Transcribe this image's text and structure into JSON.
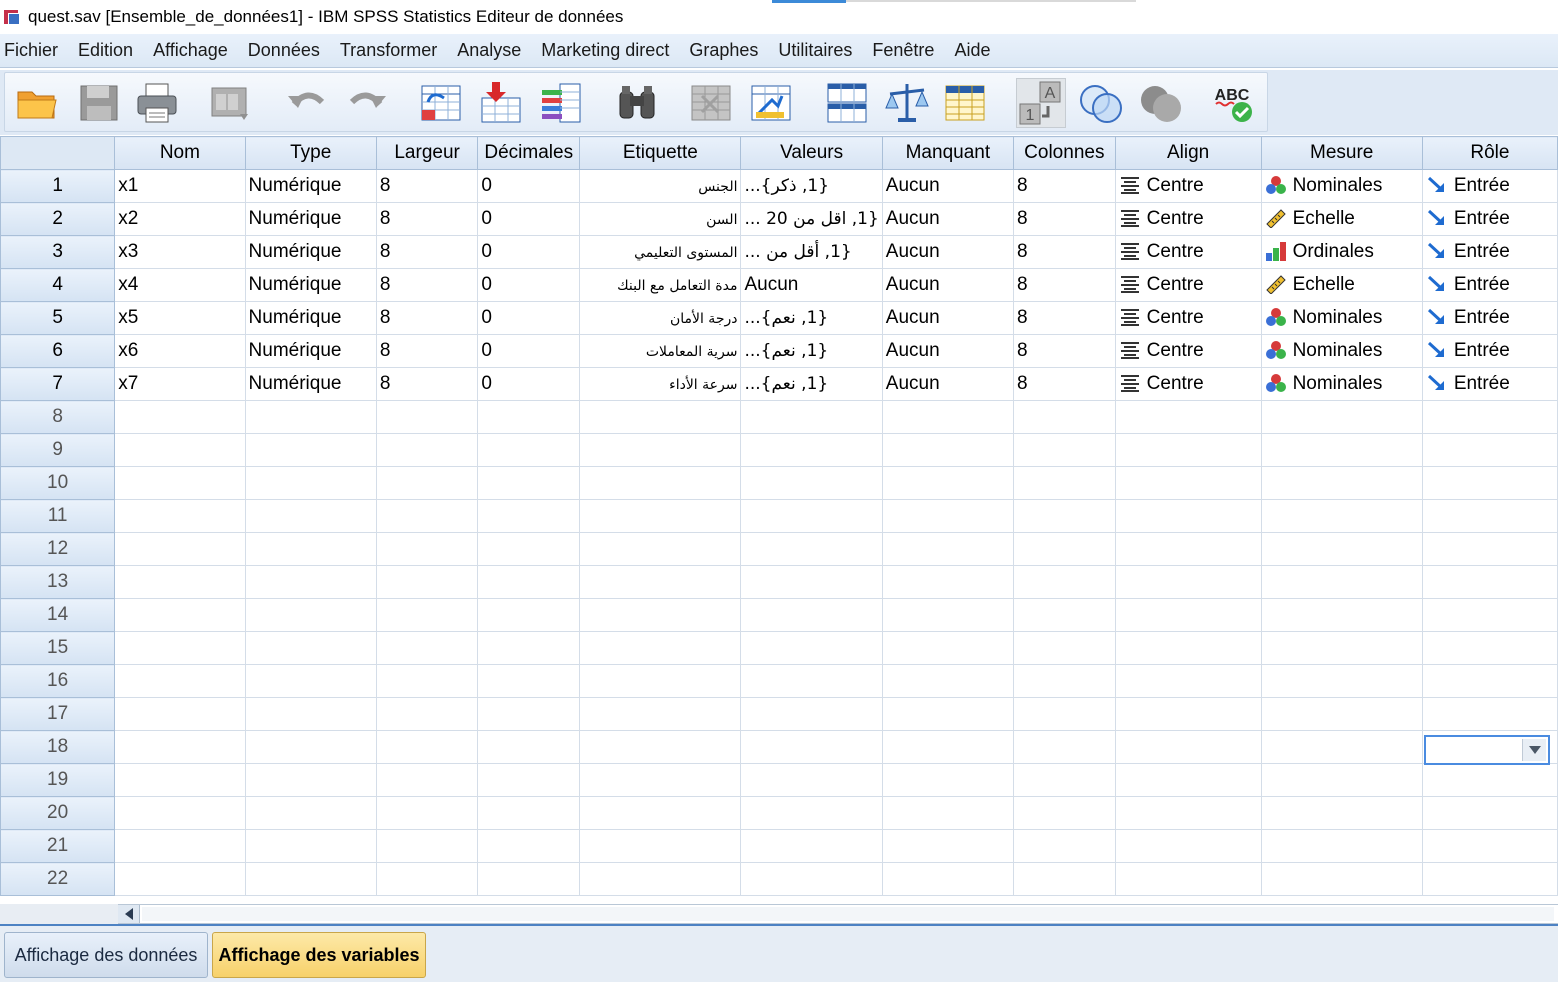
{
  "window": {
    "title": "quest.sav [Ensemble_de_données1] - IBM SPSS Statistics Editeur de données"
  },
  "menu": [
    "Fichier",
    "Edition",
    "Affichage",
    "Données",
    "Transformer",
    "Analyse",
    "Marketing direct",
    "Graphes",
    "Utilitaires",
    "Fenêtre",
    "Aide"
  ],
  "toolbar": {
    "buttons": [
      "open-file-icon",
      "save-icon",
      "print-icon",
      "recall-dialog-icon",
      "undo-icon",
      "redo-icon",
      "goto-case-icon",
      "goto-variable-icon",
      "variables-icon",
      "find-icon",
      "insert-cases-icon",
      "insert-variable-icon",
      "split-file-icon",
      "select-cases-icon",
      "weight-cases-icon",
      "value-labels-icon",
      "use-sets-icon",
      "show-all-variables-icon",
      "spell-check-icon"
    ]
  },
  "grid": {
    "columns": [
      "Nom",
      "Type",
      "Largeur",
      "Décimales",
      "Etiquette",
      "Valeurs",
      "Manquant",
      "Colonnes",
      "Align",
      "Mesure",
      "Rôle"
    ],
    "rows": [
      {
        "num": "1",
        "nom": "x1",
        "type": "Numérique",
        "largeur": "8",
        "decimales": "0",
        "etiquette": "الجنس",
        "valeurs": "{1, ذكر}...",
        "manquant": "Aucun",
        "colonnes": "8",
        "align": "Centre",
        "mesure": "Nominales",
        "mesure_icon": "nominal-icon",
        "role": "Entrée"
      },
      {
        "num": "2",
        "nom": "x2",
        "type": "Numérique",
        "largeur": "8",
        "decimales": "0",
        "etiquette": "السن",
        "valeurs": "{1, اقل من 20 ...",
        "manquant": "Aucun",
        "colonnes": "8",
        "align": "Centre",
        "mesure": "Echelle",
        "mesure_icon": "scale-icon",
        "role": "Entrée"
      },
      {
        "num": "3",
        "nom": "x3",
        "type": "Numérique",
        "largeur": "8",
        "decimales": "0",
        "etiquette": "المستوى التعليمي",
        "valeurs": "{1, أقل من ...",
        "manquant": "Aucun",
        "colonnes": "8",
        "align": "Centre",
        "mesure": "Ordinales",
        "mesure_icon": "ordinal-icon",
        "role": "Entrée"
      },
      {
        "num": "4",
        "nom": "x4",
        "type": "Numérique",
        "largeur": "8",
        "decimales": "0",
        "etiquette": "مدة التعامل مع البنك",
        "valeurs": "Aucun",
        "manquant": "Aucun",
        "colonnes": "8",
        "align": "Centre",
        "mesure": "Echelle",
        "mesure_icon": "scale-icon",
        "role": "Entrée"
      },
      {
        "num": "5",
        "nom": "x5",
        "type": "Numérique",
        "largeur": "8",
        "decimales": "0",
        "etiquette": "درجة الأمان",
        "valeurs": "{1, نعم}...",
        "manquant": "Aucun",
        "colonnes": "8",
        "align": "Centre",
        "mesure": "Nominales",
        "mesure_icon": "nominal-icon",
        "role": "Entrée"
      },
      {
        "num": "6",
        "nom": "x6",
        "type": "Numérique",
        "largeur": "8",
        "decimales": "0",
        "etiquette": "سرية المعاملات",
        "valeurs": "{1, نعم}...",
        "manquant": "Aucun",
        "colonnes": "8",
        "align": "Centre",
        "mesure": "Nominales",
        "mesure_icon": "nominal-icon",
        "role": "Entrée"
      },
      {
        "num": "7",
        "nom": "x7",
        "type": "Numérique",
        "largeur": "8",
        "decimales": "0",
        "etiquette": "سرعة الأداء",
        "valeurs": "{1, نعم}...",
        "manquant": "Aucun",
        "colonnes": "8",
        "align": "Centre",
        "mesure": "Nominales",
        "mesure_icon": "nominal-icon",
        "role": "Entrée"
      }
    ],
    "empty_rows": [
      "8",
      "9",
      "10",
      "11",
      "12",
      "13",
      "14",
      "15",
      "16",
      "17",
      "18",
      "19",
      "20",
      "21",
      "22"
    ],
    "align_icon": "align-center-icon",
    "role_icon": "input-arrow-icon",
    "active_cell": {
      "row": "14",
      "column": "Rôle",
      "value": ""
    }
  },
  "tabs": {
    "data_view": "Affichage des données",
    "variable_view": "Affichage des variables",
    "active": "variable_view"
  },
  "colors": {
    "header_bg": "#d7e4f3",
    "active_tab": "#f7d16a",
    "grid_line": "#d4dde8",
    "accent": "#4a8be0"
  }
}
